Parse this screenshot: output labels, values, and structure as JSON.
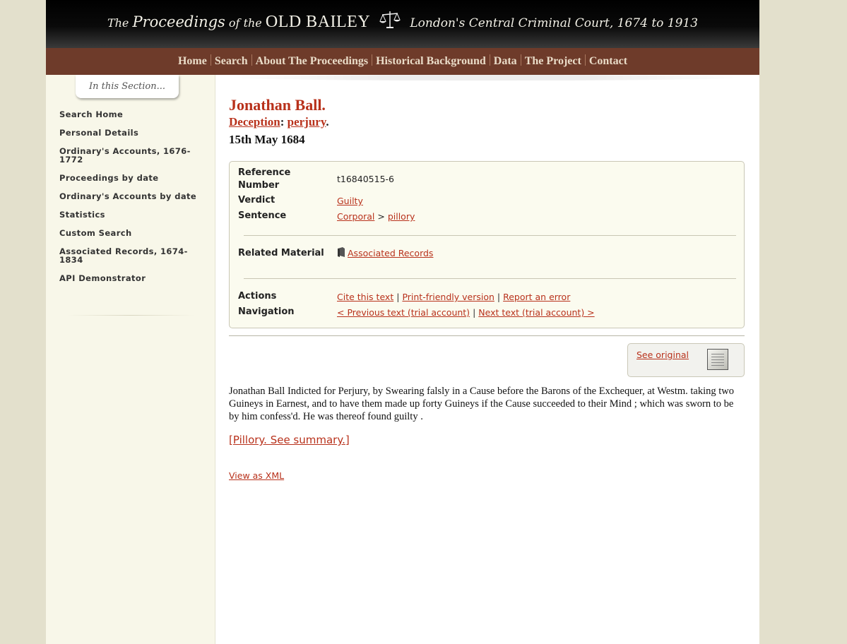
{
  "banner": {
    "the": "The",
    "proceedings": "Proceedings",
    "of_the": "of the",
    "old_bailey": "OLD BAILEY",
    "subtitle": "London's Central Criminal Court, 1674 to 1913"
  },
  "nav": [
    "Home",
    "Search",
    "About The Proceedings",
    "Historical Background",
    "Data",
    "The Project",
    "Contact"
  ],
  "sidebar": {
    "section_tab": "In this Section...",
    "links": [
      "Search Home",
      "Personal Details",
      "Ordinary's Accounts, 1676-1772",
      "Proceedings by date",
      "Ordinary's Accounts by date",
      "Statistics",
      "Custom Search",
      "Associated Records, 1674-1834",
      "API Demonstrator"
    ]
  },
  "trial": {
    "name": "Jonathan Ball.",
    "offence_category": "Deception",
    "offence_sep": ":",
    "offence": "perjury",
    "offence_end": ".",
    "date": "15th May 1684"
  },
  "info": {
    "reference_label": "Reference Number",
    "reference_value": "t16840515-6",
    "verdict_label": "Verdict",
    "verdict_value": "Guilty",
    "sentence_label": "Sentence",
    "sentence_category": "Corporal",
    "sentence_arrow": ">",
    "sentence_value": "pillory",
    "related_label": "Related Material",
    "related_link": "Associated Records",
    "actions_label": "Actions",
    "cite": "Cite this text",
    "print": "Print-friendly version",
    "report": "Report an error",
    "pipe": "|",
    "navigation_label": "Navigation",
    "prev": "< Previous text (trial account)",
    "next": "Next text (trial account) >"
  },
  "see_original": "See original",
  "text": "Jonathan Ball Indicted for Perjury, by Swearing falsly in a Cause before the Barons of the Exchequer, at Westm. taking two Guineys in Earnest, and to have them made up forty Guineys if the Cause succeeded to their Mind ; which was sworn to be by him confess'd. He was thereof found guilty .",
  "summary_link": "[Pillory. See summary.]",
  "xml_link": "View as XML",
  "colors": {
    "link": "#b8311b",
    "navbar": "#6e3b2a",
    "sidebar_bg": "#f8f7e9",
    "page_bg": "#e3e0cc"
  },
  "icons": [
    "scales-icon",
    "book-icon",
    "document-thumbnail-icon"
  ]
}
